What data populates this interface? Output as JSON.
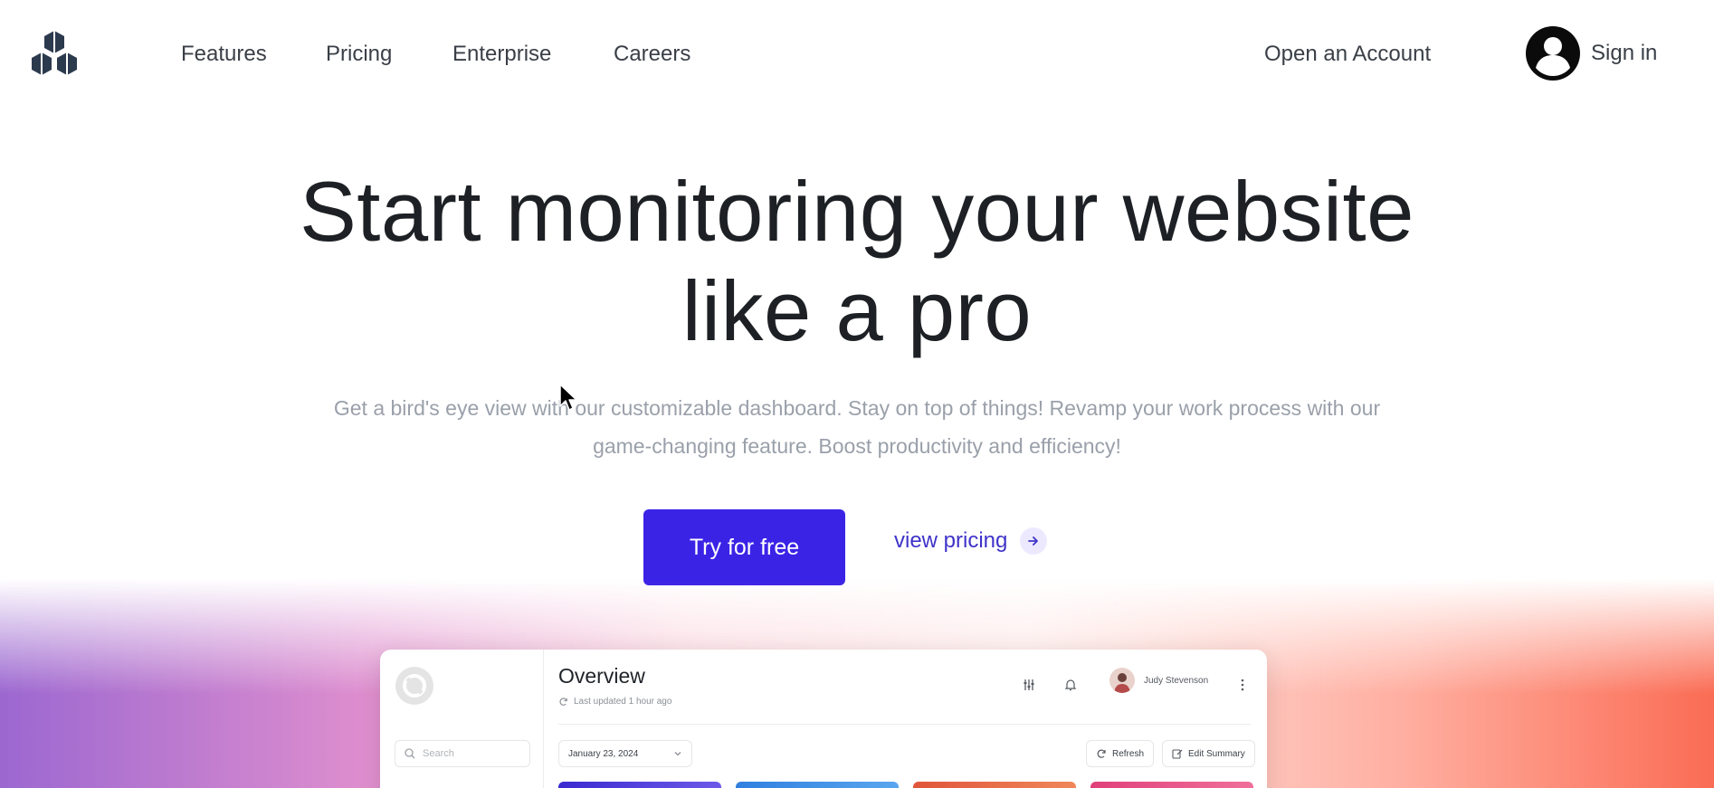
{
  "nav": {
    "links": [
      "Features",
      "Pricing",
      "Enterprise",
      "Careers"
    ],
    "open_account": "Open an Account",
    "sign_in": "Sign in"
  },
  "hero": {
    "title_line1": "Start monitoring your website",
    "title_line2": "like a pro",
    "subtitle_line1": "Get a bird's eye view with our customizable dashboard. Stay on top of things! Revamp your work process with our",
    "subtitle_line2": "game-changing feature. Boost productivity and efficiency!",
    "cta_primary": "Try for free",
    "cta_secondary": "view pricing"
  },
  "dashboard": {
    "title": "Overview",
    "last_updated": "Last updated 1 hour ago",
    "search_placeholder": "Search",
    "user_name": "Judy Stevenson",
    "date": "January 23, 2024",
    "refresh_label": "Refresh",
    "edit_summary_label": "Edit Summary"
  },
  "colors": {
    "primary": "#3b23e6",
    "link": "#3f33c9",
    "logo": "#2c3a4e"
  },
  "icons": [
    "logo-icon",
    "user-avatar-icon",
    "arrow-right-icon",
    "refresh-icon",
    "search-icon",
    "sliders-icon",
    "bell-icon",
    "more-vertical-icon",
    "chevron-down-icon",
    "edit-icon",
    "mouse-pointer-icon"
  ]
}
